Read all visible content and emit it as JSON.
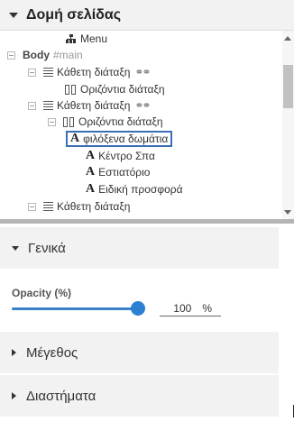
{
  "structure": {
    "title": "Δομή σελίδας",
    "tree": [
      {
        "label": "Menu",
        "icon": "sitemap-icon"
      },
      {
        "label": "Body",
        "id": "#main",
        "icon": "none"
      },
      {
        "label": "Κάθετη διάταξη",
        "icon": "vertical-layout-icon",
        "linked": true
      },
      {
        "label": "Οριζόντια διάταξη",
        "icon": "horizontal-layout-icon"
      },
      {
        "label": "Κάθετη διάταξη",
        "icon": "vertical-layout-icon",
        "linked": true
      },
      {
        "label": "Οριζόντια διάταξη",
        "icon": "horizontal-layout-icon"
      },
      {
        "label": "φιλόξενα δωμάτια",
        "icon": "text-icon",
        "selected": true
      },
      {
        "label": "Κέντρο Σπα",
        "icon": "text-icon"
      },
      {
        "label": "Εστιατόριο",
        "icon": "text-icon"
      },
      {
        "label": "Ειδική προσφορά",
        "icon": "text-icon"
      },
      {
        "label": "Κάθετη διάταξη",
        "icon": "vertical-layout-icon"
      }
    ]
  },
  "general": {
    "title": "Γενικά",
    "opacity_label": "Opacity (%)",
    "opacity_value": "100",
    "opacity_unit": "%",
    "opacity_level": 1.0
  },
  "size": {
    "title": "Μέγεθος"
  },
  "spacing": {
    "title": "Διαστήματα"
  },
  "colors": {
    "accent": "#2c7fd1",
    "selection_border": "#3a6fb5",
    "header_bg": "#f2f2f2"
  }
}
